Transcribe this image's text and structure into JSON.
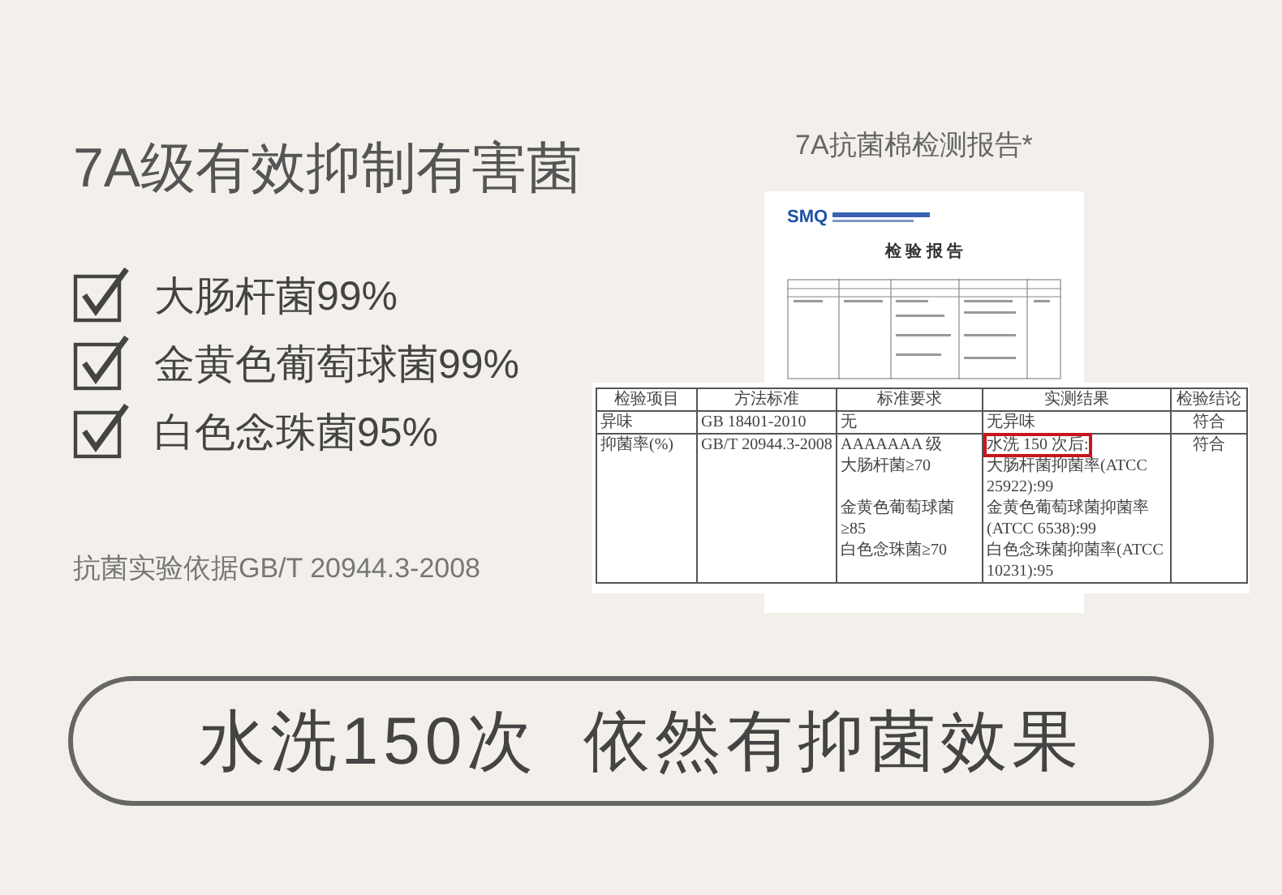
{
  "headline": "7A级有效抑制有害菌",
  "checklist": [
    {
      "label": "大肠杆菌99%",
      "checked": true
    },
    {
      "label": "金黄色葡萄球菌99%",
      "checked": true
    },
    {
      "label": "白色念珠菌95%",
      "checked": true
    }
  ],
  "basis": "抗菌实验依据GB/T 20944.3-2008",
  "report": {
    "caption": "7A抗菌棉检测报告*",
    "logo": "SMQ",
    "title": "检 验 报 告",
    "table": {
      "columns": [
        "检验项目",
        "方法标准",
        "标准要求",
        "实测结果",
        "检验结论"
      ],
      "rows": [
        {
          "cells": [
            {
              "lines": [
                "异味"
              ],
              "boxed": false
            },
            {
              "lines": [
                "GB 18401-2010"
              ],
              "boxed": false
            },
            {
              "lines": [
                "无"
              ],
              "boxed": false
            },
            {
              "lines": [
                "无异味"
              ],
              "boxed": false
            },
            {
              "lines": [
                "符合"
              ],
              "boxed": false
            }
          ]
        },
        {
          "cells": [
            {
              "lines": [
                "抑菌率(%)"
              ],
              "boxed": false
            },
            {
              "lines": [
                "GB/T 20944.3-2008"
              ],
              "boxed": false
            },
            {
              "lines": [
                "AAAAAAA 级",
                "大肠杆菌≥70",
                "金黄色葡萄球菌≥85",
                "白色念珠菌≥70"
              ],
              "boxed": false
            },
            {
              "lines": [
                "水洗 150 次后:",
                "大肠杆菌抑菌率(ATCC 25922):99",
                "金黄色葡萄球菌抑菌率(ATCC 6538):99",
                "白色念珠菌抑菌率(ATCC 10231):95"
              ],
              "boxed": true
            },
            {
              "lines": [
                "符合"
              ],
              "boxed": false
            }
          ]
        }
      ]
    }
  },
  "slogan": [
    "水洗150次",
    "依然有抑菌效果"
  ]
}
